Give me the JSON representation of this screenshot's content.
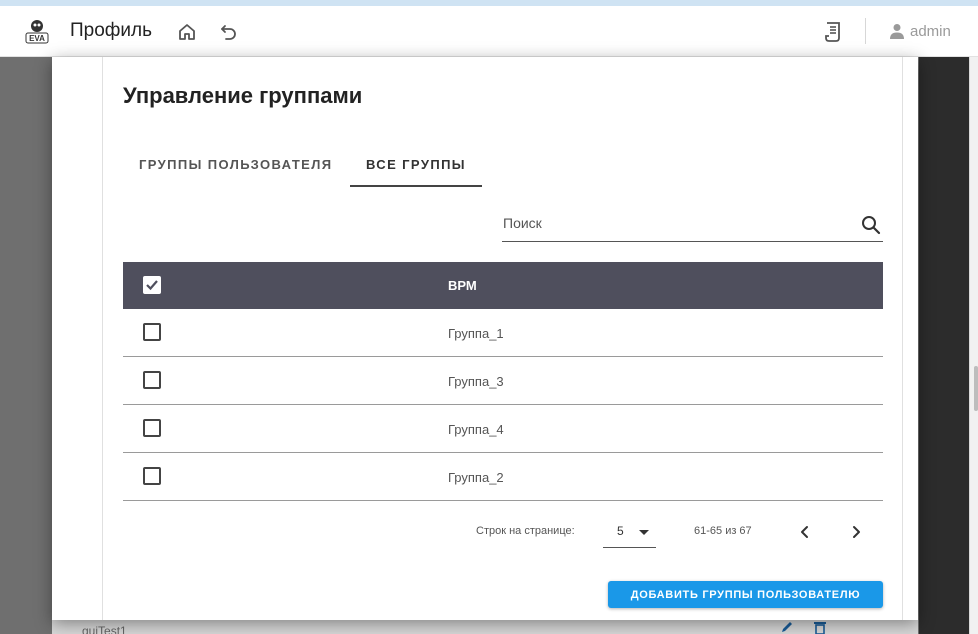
{
  "appbar": {
    "logo_text": "EVA",
    "title": "Профиль",
    "user_name": "admin",
    "icons": [
      "home-icon",
      "undo-icon",
      "document-icon",
      "user-icon"
    ]
  },
  "dialog": {
    "title": "Управление группами",
    "tabs": [
      {
        "label": "ГРУППЫ ПОЛЬЗОВАТЕЛЯ",
        "active": false
      },
      {
        "label": "ВСЕ ГРУППЫ",
        "active": true
      }
    ],
    "search": {
      "placeholder": "Поиск"
    },
    "table": {
      "header": {
        "column": "ВРМ",
        "all_checked": true
      },
      "rows": [
        {
          "name": "Группа_1",
          "checked": false
        },
        {
          "name": "Группа_3",
          "checked": false
        },
        {
          "name": "Группа_4",
          "checked": false
        },
        {
          "name": "Группа_2",
          "checked": false
        }
      ]
    },
    "pagination": {
      "rows_per_page_label": "Строк на странице:",
      "rows_per_page": "5",
      "range": "61-65 из 67"
    },
    "add_button": "ДОБАВИТЬ ГРУППЫ ПОЛЬЗОВАТЕЛЮ"
  },
  "background": {
    "row_text": "guiTest1"
  },
  "colors": {
    "header_bg": "#4f4f5d",
    "primary": "#1a98e8",
    "backdrop": "#6f6f6f"
  }
}
